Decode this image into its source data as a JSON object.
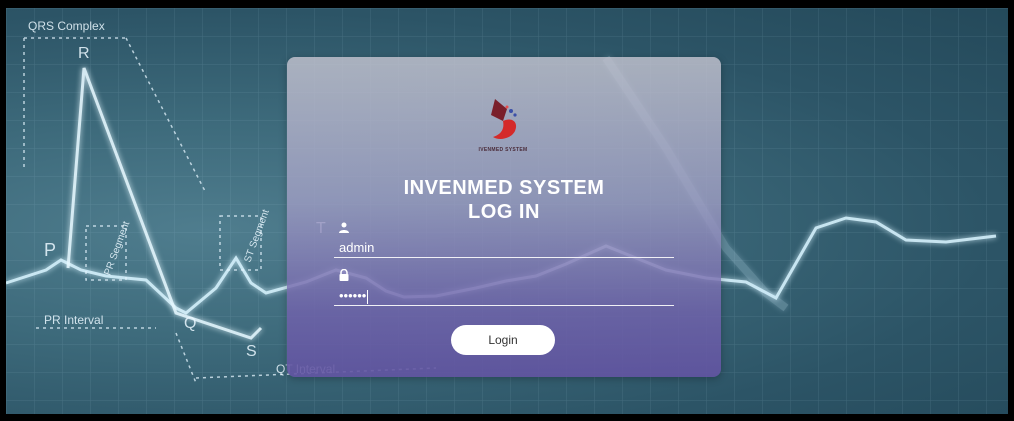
{
  "background": {
    "labels": {
      "qrs": "QRS Complex",
      "r": "R",
      "p": "P",
      "q": "Q",
      "s": "S",
      "t": "T",
      "pr_segment": "PR Segment",
      "st_segment": "ST Segment",
      "pr_interval": "PR Interval",
      "qt_interval": "QT Interval"
    },
    "colors": {
      "base": "#2c5466",
      "ecg_line": "#cfefff"
    }
  },
  "login": {
    "logo_text": "IVENMED SYSTEM",
    "title_line1": "INVENMED SYSTEM",
    "title_line2": "LOG IN",
    "username_value": "admin",
    "password_value": "••••••",
    "button_label": "Login",
    "icons": {
      "user": "user-icon",
      "lock": "lock-icon",
      "logo": "logo-icon"
    }
  }
}
